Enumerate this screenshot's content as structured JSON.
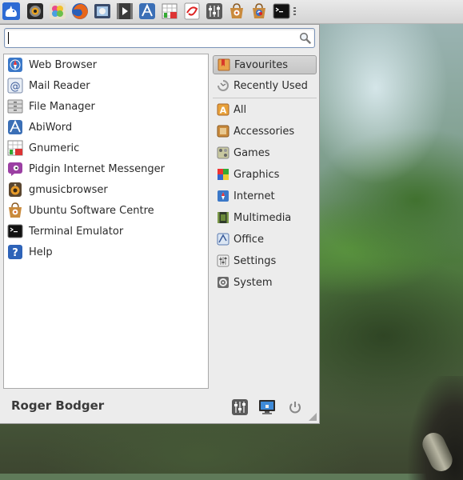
{
  "desktop": {
    "description_icon": "forest-wallpaper"
  },
  "panel": {
    "launchers": [
      {
        "name": "xfce-menu-launcher",
        "icon": "xfce-mouse-icon"
      },
      {
        "name": "camera-launcher",
        "icon": "camera-icon"
      },
      {
        "name": "photos-launcher",
        "icon": "flower-photos-icon"
      },
      {
        "name": "firefox-launcher",
        "icon": "firefox-icon"
      },
      {
        "name": "image-viewer-launcher",
        "icon": "image-viewer-icon"
      },
      {
        "name": "media-player-launcher",
        "icon": "media-player-icon"
      },
      {
        "name": "abiword-launcher",
        "icon": "abiword-icon"
      },
      {
        "name": "gnumeric-launcher",
        "icon": "gnumeric-icon"
      },
      {
        "name": "pdf-launcher",
        "icon": "pdf-icon"
      },
      {
        "name": "settings-launcher",
        "icon": "sliders-icon"
      },
      {
        "name": "software-centre-launcher",
        "icon": "software-centre-icon"
      },
      {
        "name": "software-update-launcher",
        "icon": "software-update-icon"
      },
      {
        "name": "terminal-launcher",
        "icon": "terminal-icon"
      }
    ]
  },
  "search": {
    "value": "",
    "placeholder": ""
  },
  "favourites": [
    {
      "label": "Web Browser",
      "icon": "web-browser-icon"
    },
    {
      "label": "Mail Reader",
      "icon": "mail-icon"
    },
    {
      "label": "File Manager",
      "icon": "file-manager-icon"
    },
    {
      "label": "AbiWord",
      "icon": "abiword-icon"
    },
    {
      "label": "Gnumeric",
      "icon": "gnumeric-icon"
    },
    {
      "label": "Pidgin Internet Messenger",
      "icon": "pidgin-icon"
    },
    {
      "label": "gmusicbrowser",
      "icon": "speaker-icon"
    },
    {
      "label": "Ubuntu Software Centre",
      "icon": "software-centre-icon"
    },
    {
      "label": "Terminal Emulator",
      "icon": "terminal-icon"
    },
    {
      "label": "Help",
      "icon": "help-icon"
    }
  ],
  "categories": [
    {
      "label": "Favourites",
      "icon": "bookmark-icon",
      "active": true
    },
    {
      "label": "Recently Used",
      "icon": "recent-icon",
      "active": false
    },
    {
      "label": "All",
      "icon": "all-icon",
      "active": false
    },
    {
      "label": "Accessories",
      "icon": "accessories-icon",
      "active": false
    },
    {
      "label": "Games",
      "icon": "games-icon",
      "active": false
    },
    {
      "label": "Graphics",
      "icon": "graphics-icon",
      "active": false
    },
    {
      "label": "Internet",
      "icon": "internet-icon",
      "active": false
    },
    {
      "label": "Multimedia",
      "icon": "multimedia-icon",
      "active": false
    },
    {
      "label": "Office",
      "icon": "office-icon",
      "active": false
    },
    {
      "label": "Settings",
      "icon": "settings-icon",
      "active": false
    },
    {
      "label": "System",
      "icon": "system-icon",
      "active": false
    }
  ],
  "footer": {
    "user_name": "Roger Bodger",
    "buttons": [
      {
        "name": "settings-manager-button",
        "icon": "sliders-icon"
      },
      {
        "name": "lock-screen-button",
        "icon": "monitor-lock-icon"
      },
      {
        "name": "log-out-button",
        "icon": "power-icon"
      }
    ]
  },
  "colors": {
    "menu_bg": "#ececec",
    "active_category": "#c9c9c9",
    "search_border": "#7a93b8"
  }
}
